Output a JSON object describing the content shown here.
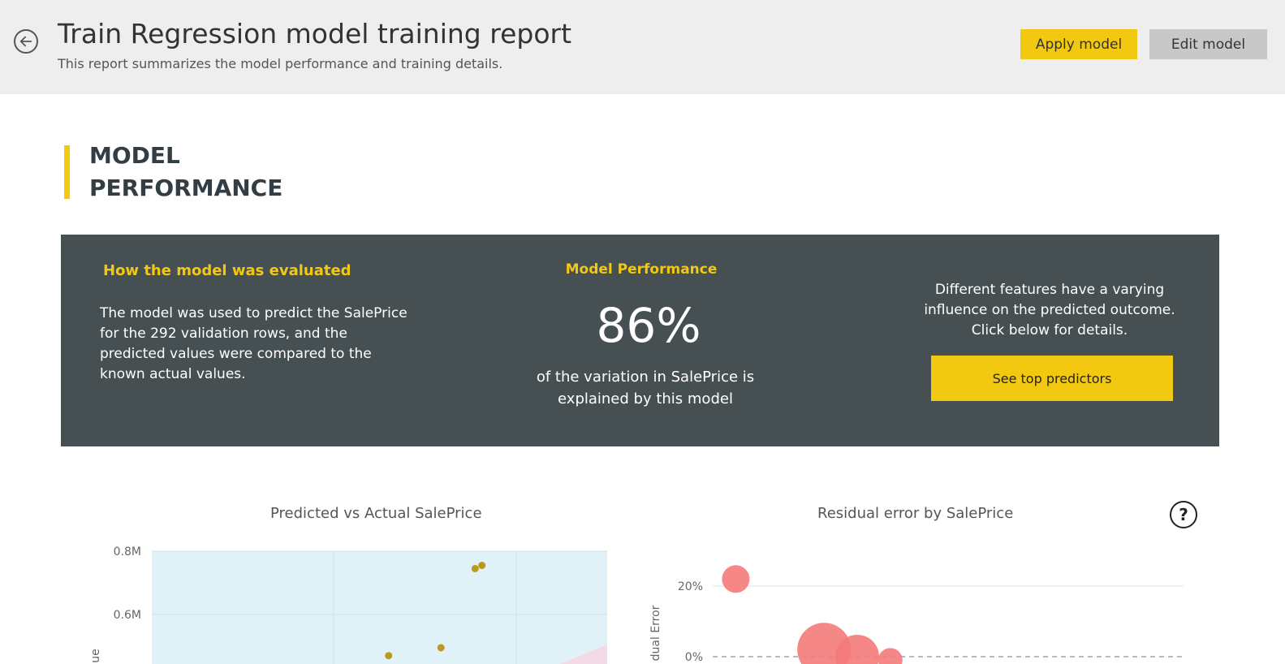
{
  "header": {
    "title": "Train Regression model training report",
    "subtitle": "This report summarizes the model performance and training details.",
    "apply_label": "Apply model",
    "edit_label": "Edit model"
  },
  "section": {
    "title_line1": "MODEL",
    "title_line2": "PERFORMANCE"
  },
  "panel": {
    "left_heading": "How the model was evaluated",
    "left_text": "The model was used to predict the SalePrice for the 292 validation rows, and the predicted values were compared to the known actual values.",
    "mid_heading": "Model Performance",
    "mid_value": "86%",
    "mid_text": "of the variation in SalePrice is explained by this model",
    "right_text": "Different features have a varying influence on the predicted outcome. Click below for details.",
    "right_button": "See top predictors"
  },
  "charts": {
    "help_glyph": "?"
  },
  "chart_data": [
    {
      "type": "scatter",
      "title": "Predicted vs Actual SalePrice",
      "ytick_labels": [
        "0.8M",
        "0.6M"
      ],
      "ylabel_visible": "ue",
      "points": [
        {
          "x": 0.71,
          "y": 0.745
        },
        {
          "x": 0.725,
          "y": 0.755
        },
        {
          "x": 0.52,
          "y": 0.47
        },
        {
          "x": 0.635,
          "y": 0.495
        }
      ],
      "colors": {
        "plot_bg": "#e1f1f8",
        "point": "#b89b1e",
        "band": "#f2dbe6"
      }
    },
    {
      "type": "scatter",
      "title": "Residual error by SalePrice",
      "ytick_labels": [
        "20%",
        "0%"
      ],
      "ylabel_visible": "dual Error",
      "points": [
        {
          "x": 0.18,
          "y": 22,
          "size": 17
        },
        {
          "x": 0.34,
          "y": 2,
          "size": 33
        },
        {
          "x": 0.4,
          "y": 0,
          "size": 27
        },
        {
          "x": 0.46,
          "y": -1,
          "size": 15
        }
      ],
      "colors": {
        "point": "#f57a7a"
      }
    }
  ]
}
